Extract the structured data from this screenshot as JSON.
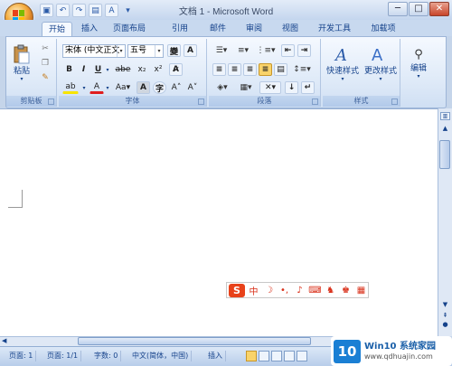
{
  "window": {
    "title": "文档 1 - Microsoft Word"
  },
  "tabs": [
    {
      "label": "开始"
    },
    {
      "label": "插入"
    },
    {
      "label": "页面布局"
    },
    {
      "label": "引用"
    },
    {
      "label": "邮件"
    },
    {
      "label": "审阅"
    },
    {
      "label": "视图"
    },
    {
      "label": "开发工具"
    },
    {
      "label": "加载项"
    }
  ],
  "groups": {
    "clipboard": {
      "label": "剪贴板",
      "paste": "粘贴"
    },
    "font": {
      "label": "字体",
      "font_name": "宋体 (中文正文",
      "font_size": "五号"
    },
    "paragraph": {
      "label": "段落"
    },
    "styles": {
      "label": "样式",
      "quick_styles": "快速样式",
      "change_styles": "更改样式"
    },
    "editing": {
      "label": "编辑"
    }
  },
  "status": {
    "page": "页面: 1",
    "pages": "页面: 1/1",
    "words": "字数: 0",
    "language": "中文(简体，中国)",
    "mode": "插入"
  },
  "ime": {
    "logo": "S",
    "mode": "中"
  },
  "watermark": {
    "brand_num": "10",
    "line1": "Win10 系统家园",
    "line2": "www.qdhuajin.com"
  }
}
